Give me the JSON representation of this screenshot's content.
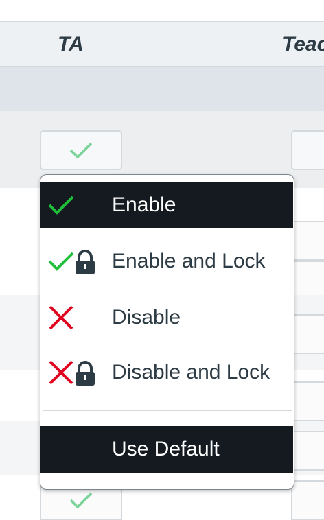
{
  "columns": {
    "ta": "TA",
    "teacher": "Teac"
  },
  "menu": {
    "items": [
      {
        "label": "Enable",
        "icon": "check-icon",
        "selected": true
      },
      {
        "label": "Enable and Lock",
        "icon": "check-lock-icon",
        "selected": false
      },
      {
        "label": "Disable",
        "icon": "x-icon",
        "selected": false
      },
      {
        "label": "Disable and Lock",
        "icon": "x-lock-icon",
        "selected": false
      }
    ],
    "default": {
      "label": "Use Default",
      "selected": true
    }
  },
  "colors": {
    "check": "#1fbf3a",
    "cross": "#e0061f",
    "lock": "#2d3b45",
    "selected_bg": "#141a20",
    "light_check": "#7cd49a"
  }
}
